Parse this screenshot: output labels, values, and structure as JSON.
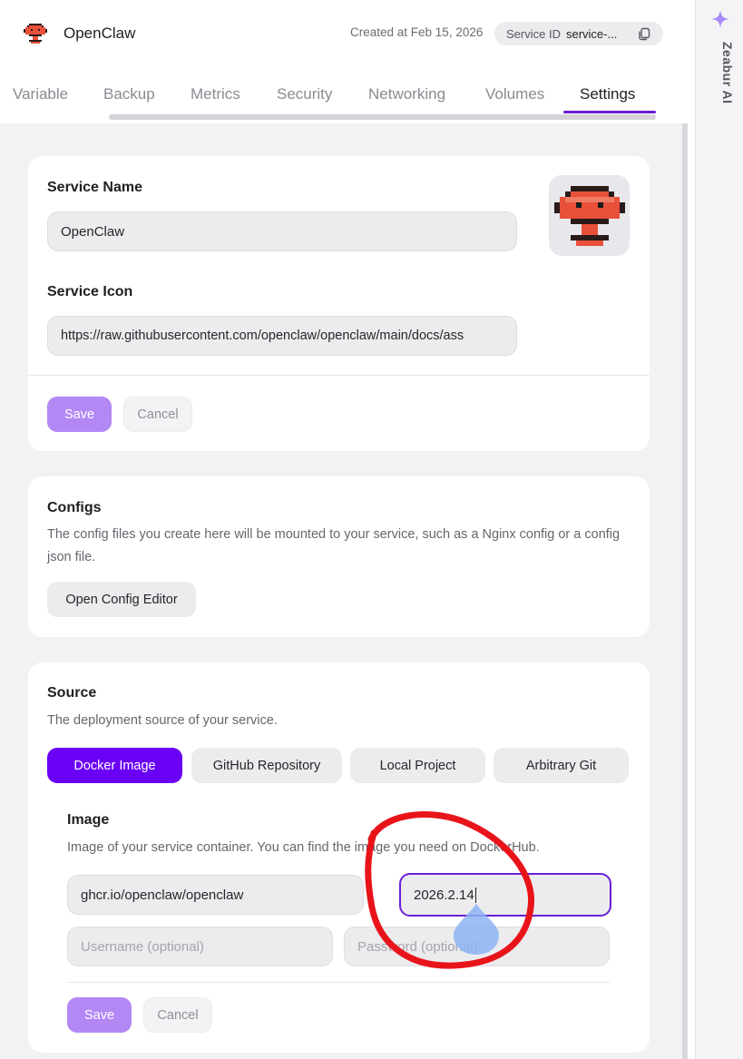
{
  "header": {
    "app_title": "OpenClaw",
    "created_at": "Created at Feb 15, 2026",
    "service_id_label": "Service ID",
    "service_id_value": "service-...",
    "logo_icon": "openclaw-robot-icon",
    "copy_icon": "copy-icon"
  },
  "tabs": [
    {
      "label": "Variable",
      "active": false
    },
    {
      "label": "Backup",
      "active": false
    },
    {
      "label": "Metrics",
      "active": false
    },
    {
      "label": "Security",
      "active": false
    },
    {
      "label": "Networking",
      "active": false
    },
    {
      "label": "Volumes",
      "active": false
    },
    {
      "label": "Settings",
      "active": true
    }
  ],
  "service_card": {
    "name_label": "Service Name",
    "name_value": "OpenClaw",
    "icon_label": "Service Icon",
    "icon_value": "https://raw.githubusercontent.com/openclaw/openclaw/main/docs/ass",
    "save_label": "Save",
    "cancel_label": "Cancel"
  },
  "configs_card": {
    "title": "Configs",
    "description": "The config files you create here will be mounted to your service, such as a Nginx config or a config json file.",
    "button_label": "Open Config Editor"
  },
  "source_card": {
    "title": "Source",
    "description": "The deployment source of your service.",
    "source_options": [
      {
        "label": "Docker Image",
        "selected": true
      },
      {
        "label": "GitHub Repository",
        "selected": false
      },
      {
        "label": "Local Project",
        "selected": false
      },
      {
        "label": "Arbitrary Git",
        "selected": false
      }
    ],
    "image_title": "Image",
    "image_description": "Image of your service container. You can find the image you need on DockerHub.",
    "image_value": "ghcr.io/openclaw/openclaw",
    "tag_value": "2026.2.14",
    "username_placeholder": "Username (optional)",
    "password_placeholder": "Password (optional)",
    "save_label": "Save",
    "cancel_label": "Cancel"
  },
  "right_rail": {
    "label": "Zeabur AI",
    "icon": "sparkle-icon"
  },
  "colors": {
    "accent": "#6a00f4",
    "accent_disabled": "#b388f5",
    "annotation_red": "#e8141a",
    "touch_blue": "#8db4f5"
  }
}
